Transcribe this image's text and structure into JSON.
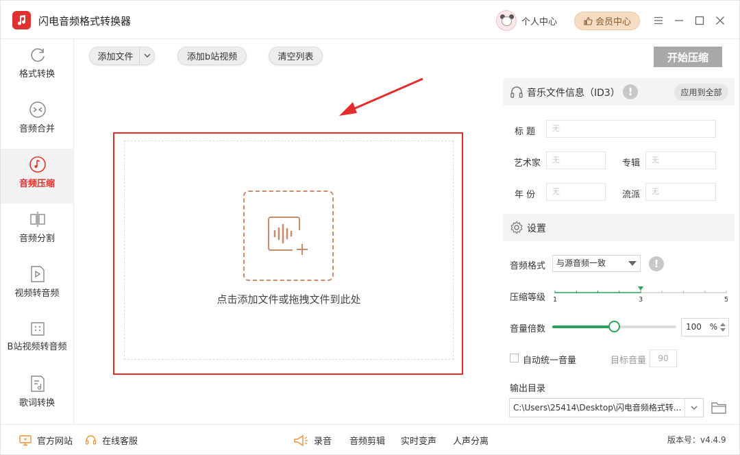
{
  "app": {
    "title": "闪电音频格式转换器",
    "user_center": "个人中心",
    "vip_center": "会员中心",
    "window_controls": [
      "menu-icon",
      "minimize-icon",
      "maximize-icon",
      "close-icon"
    ]
  },
  "sidebar": {
    "items": [
      {
        "label": "格式转换",
        "icon": "refresh-icon",
        "active": false
      },
      {
        "label": "音频合并",
        "icon": "merge-icon",
        "active": false
      },
      {
        "label": "音频压缩",
        "icon": "music-note-icon",
        "active": true
      },
      {
        "label": "音频分割",
        "icon": "split-icon",
        "active": false
      },
      {
        "label": "视频转音频",
        "icon": "video-to-audio-icon",
        "active": false
      },
      {
        "label": "B站视频转音频",
        "icon": "bilibili-icon",
        "active": false
      },
      {
        "label": "歌词转换",
        "icon": "lyrics-icon",
        "active": false
      }
    ]
  },
  "toolbar": {
    "add_file": "添加文件",
    "add_bilibili": "添加b站视频",
    "clear_list": "清空列表",
    "start": "开始压缩"
  },
  "drop_area": {
    "hint": "点击添加文件或拖拽文件到此处"
  },
  "music_info": {
    "header": "音乐文件信息（ID3）",
    "apply_all": "应用到全部",
    "fields": {
      "title_label": "标  题",
      "artist_label": "艺术家",
      "album_label": "专辑",
      "year_label": "年  份",
      "genre_label": "流派",
      "placeholder": "无"
    }
  },
  "settings": {
    "header": "设置",
    "audio_format_label": "音频格式",
    "audio_format_value": "与源音频一致",
    "compression_label": "压缩等级",
    "compression_ticks": [
      "1",
      "3",
      "5"
    ],
    "compression_level": 3,
    "compression_min": 1,
    "compression_max": 5,
    "volume_label": "音量倍数",
    "volume_value": "100",
    "volume_unit": "%",
    "volume_fraction": 0.5,
    "auto_volume_label": "自动统一音量",
    "auto_volume_checked": false,
    "target_volume_label": "目标音量",
    "target_volume_value": "90",
    "output_dir_label": "输出目录",
    "output_dir_value": "C:\\Users\\25414\\Desktop\\闪电音频格式转..."
  },
  "footer": {
    "website": "官方网站",
    "support": "在线客服",
    "record": "录音",
    "audio_edit": "音频剪辑",
    "voice_change": "实时变声",
    "vocal_split": "人声分离",
    "version": "版本号：v4.4.9"
  },
  "colors": {
    "accent_red": "#e0322d",
    "slider_green": "#2aa35a",
    "vip_bg": "#f6dcc3",
    "disabled_button": "#a9a9a9"
  }
}
